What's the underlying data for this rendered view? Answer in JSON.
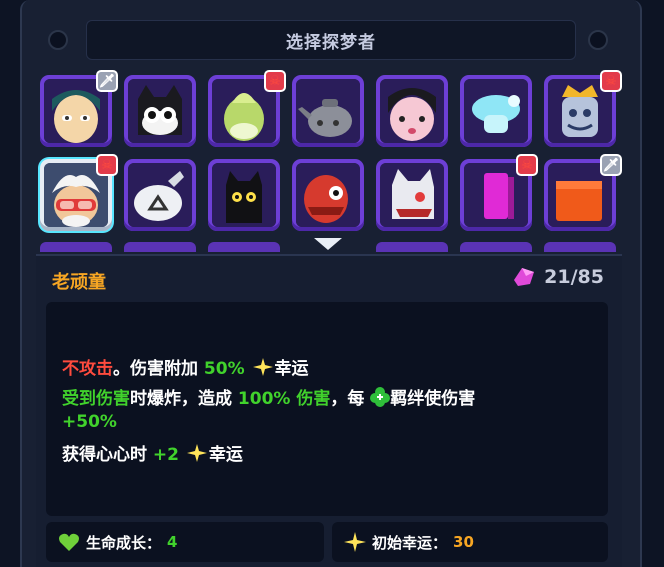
{
  "title": "选择探梦者",
  "grid": {
    "row1": [
      {
        "character": "teal-haired-girl",
        "badge": "gray-sword"
      },
      {
        "character": "black-white-cat",
        "badge": ""
      },
      {
        "character": "green-cabbage",
        "badge": "red-skull"
      },
      {
        "character": "gray-kettle",
        "badge": ""
      },
      {
        "character": "pink-faced-girl",
        "badge": ""
      },
      {
        "character": "cyan-cloud-creature",
        "badge": ""
      },
      {
        "character": "blue-mask-king",
        "badge": "red-skull"
      }
    ],
    "row2": [
      {
        "character": "old-man-goggles",
        "badge": "red-skull",
        "selected": true
      },
      {
        "character": "white-money-bag",
        "badge": ""
      },
      {
        "character": "black-cat-yellow-eyes",
        "badge": ""
      },
      {
        "character": "red-fish-monster",
        "badge": ""
      },
      {
        "character": "white-wolf-red-eye",
        "badge": ""
      },
      {
        "character": "magenta-block",
        "badge": "red-skull"
      },
      {
        "character": "orange-block",
        "badge": "gray-sword"
      }
    ]
  },
  "selected": {
    "name": "老顽童",
    "progress": "21/85",
    "progress_icon": "pink-crystal-icon",
    "description": {
      "line1": {
        "a": "不攻击",
        "b": "。伤害附加 ",
        "c": "50%",
        "d": "幸运"
      },
      "line2": {
        "a": "受到伤害",
        "b": "时爆炸，造成 ",
        "c": "100% 伤害",
        "d": "，每",
        "e": "羁绊使伤害"
      },
      "line3": {
        "a": "+50%"
      },
      "line4": {
        "a": "获得心心时 ",
        "b": "+2",
        "c": "幸运"
      }
    },
    "stats": [
      {
        "label": "生命成长：",
        "value": "4",
        "icon": "green-heart-icon"
      },
      {
        "label": "初始幸运：",
        "value": "30",
        "icon": "sparkle-icon"
      }
    ]
  },
  "colors": {
    "accent_orange": "#f7a623",
    "green": "#41d22c",
    "red": "#ff4b3e",
    "slot_purple": "#6d3fd6"
  }
}
